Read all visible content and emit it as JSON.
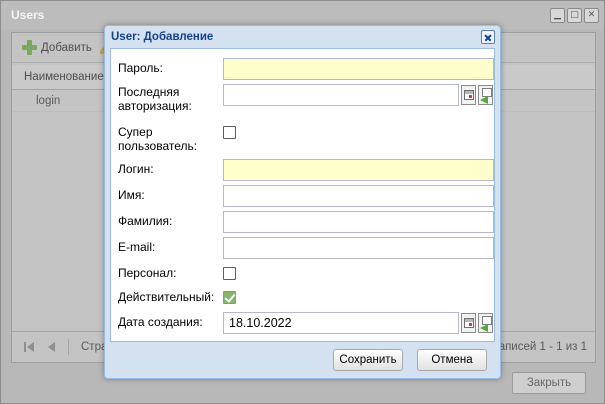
{
  "background_window": {
    "title": "Users",
    "toolbar": {
      "add_label": "Добавить"
    },
    "grid": {
      "column_header": "Наименование",
      "rows": [
        "login"
      ]
    },
    "pager": {
      "page_label": "Стран",
      "records_text": "аписей 1 - 1 из 1"
    },
    "close_label": "Закрыть"
  },
  "dialog": {
    "title": "User: Добавление",
    "fields": {
      "password": {
        "label": "Пароль:",
        "value": ""
      },
      "last_auth": {
        "label": "Последняя авторизация:",
        "value": ""
      },
      "superuser": {
        "label": "Супер пользователь:",
        "checked": false
      },
      "login": {
        "label": "Логин:",
        "value": ""
      },
      "first_name": {
        "label": "Имя:",
        "value": ""
      },
      "last_name": {
        "label": "Фамилия:",
        "value": ""
      },
      "email": {
        "label": "E-mail:",
        "value": ""
      },
      "staff": {
        "label": "Персонал:",
        "checked": false
      },
      "active": {
        "label": "Действительный:",
        "checked": true
      },
      "created": {
        "label": "Дата создания:",
        "value": "18.10.2022"
      }
    },
    "buttons": {
      "save": "Сохранить",
      "cancel": "Отмена"
    }
  }
}
